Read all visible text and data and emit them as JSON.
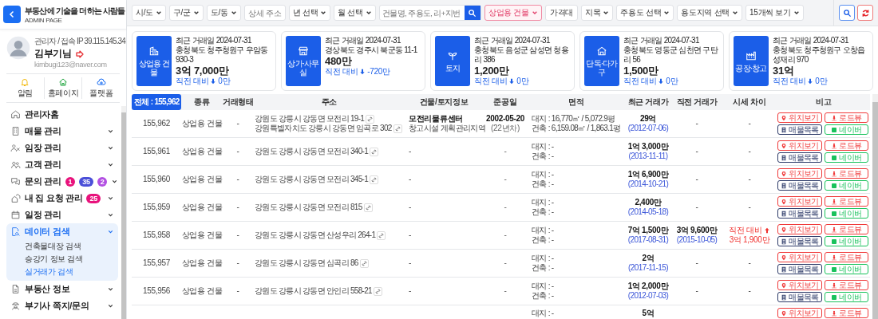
{
  "sidebar": {
    "brand": {
      "title": "부동산에 기술을 더하는 사람들",
      "subtitle": "ADMIN PAGE"
    },
    "profile": {
      "meta": "관리자 / 접속 IP 39.115.145.34",
      "name": "김부기님",
      "email": "kimbugi123@naver.com"
    },
    "quick_links": [
      {
        "label": "알림"
      },
      {
        "label": "홈페이지"
      },
      {
        "label": "플랫폼"
      }
    ],
    "nav": [
      {
        "label": "관리자홈",
        "kind": "link",
        "selected": false
      },
      {
        "label": "매물 관리",
        "kind": "group",
        "selected": false,
        "expanded": false
      },
      {
        "label": "임장 관리",
        "kind": "group",
        "selected": false,
        "expanded": false
      },
      {
        "label": "고객 관리",
        "kind": "group",
        "selected": false,
        "expanded": false
      },
      {
        "label": "문의 관리",
        "kind": "group",
        "selected": false,
        "expanded": false,
        "badges": [
          {
            "text": "1",
            "color": "#e8127c"
          },
          {
            "text": "35",
            "color": "#4a4fd8"
          },
          {
            "text": "2",
            "color": "#b24fe2"
          }
        ]
      },
      {
        "label": "내 집 요청 관리",
        "kind": "group",
        "selected": false,
        "expanded": false,
        "badges": [
          {
            "text": "25",
            "color": "#e8127c"
          }
        ]
      },
      {
        "label": "일정 관리",
        "kind": "group",
        "selected": false,
        "expanded": false
      },
      {
        "label": "데이터 검색",
        "kind": "group",
        "selected": true,
        "expanded": true,
        "children": [
          {
            "label": "건축물대장 검색",
            "selected": false
          },
          {
            "label": "승강기 정보 검색",
            "selected": false
          },
          {
            "label": "실거래가 검색",
            "selected": true
          }
        ]
      },
      {
        "label": "부동산 정보",
        "kind": "group",
        "selected": false,
        "expanded": false
      },
      {
        "label": "부기사 쪽지/문의",
        "kind": "group",
        "selected": false,
        "expanded": false
      }
    ]
  },
  "filters": [
    {
      "kind": "select",
      "label": "시/도",
      "active": false
    },
    {
      "kind": "select",
      "label": "구/군",
      "active": false
    },
    {
      "kind": "select",
      "label": "도/동",
      "active": false
    },
    {
      "kind": "input",
      "placeholder": "상세 주소"
    },
    {
      "kind": "select",
      "label": "년 선택",
      "active": false
    },
    {
      "kind": "select",
      "label": "월 선택",
      "active": false
    },
    {
      "kind": "search",
      "placeholder": "건물명, 주용도, 리+지번"
    },
    {
      "kind": "select",
      "label": "상업용 건물",
      "active": true
    },
    {
      "kind": "button",
      "label": "가격대"
    },
    {
      "kind": "select",
      "label": "지목",
      "active": false
    },
    {
      "kind": "select",
      "label": "주용도 선택",
      "active": false
    },
    {
      "kind": "select",
      "label": "용도지역 선택",
      "active": false
    },
    {
      "kind": "select",
      "label": "15개씩 보기",
      "active": false
    }
  ],
  "cards": [
    {
      "category": "상업용 건물",
      "date": "최근 거래일 2024-07-31",
      "address": "충청북도 청주청원구 우암동 930-3",
      "price": "3억 7,000만",
      "change": {
        "label": "직전 대비",
        "rising": false,
        "amount": "0만"
      }
    },
    {
      "category": "상가·사무실",
      "date": "최근 거래일 2024-07-31",
      "address": "경상북도 경주시 북군동 11-1",
      "price": "480만",
      "change": {
        "label": "직전 대비",
        "rising": false,
        "amount": "-720만"
      }
    },
    {
      "category": "토지",
      "date": "최근 거래일 2024-07-31",
      "address": "충청북도 음성군 삼성면 청용리 386",
      "price": "1,200만",
      "change": {
        "label": "직전 대비",
        "rising": false,
        "amount": "0만"
      }
    },
    {
      "category": "단독·다가구",
      "date": "최근 거래일 2024-07-31",
      "address": "충청북도 영동군 심천면 구탄리 56",
      "price": "1,500만",
      "change": {
        "label": "직전 대비",
        "rising": false,
        "amount": "0만"
      }
    },
    {
      "category": "공장·창고",
      "date": "최근 거래일 2024-07-31",
      "address": "충청북도 청주청원구 오창읍 성재리 970",
      "price": "31억",
      "change": {
        "label": "직전 대비",
        "rising": false,
        "amount": "0만"
      }
    }
  ],
  "table": {
    "total_tab": {
      "label": "전체 : 155,962",
      "selected": true
    },
    "columns": [
      "종류",
      "거래형태",
      "주소",
      "건물/토지정보",
      "준공일",
      "면적",
      "최근 거래가",
      "직전 거래가",
      "시세 차이",
      "비고"
    ],
    "rows": [
      {
        "no": "155,962",
        "type": "상업용 건물",
        "deal": "-",
        "addresses": [
          "강원도 강릉시 강동면 모전리 19-1",
          "강원특별자치도 강릉시 강동면 임곡로 302"
        ],
        "building": {
          "name": "모전리물류센터",
          "info": "창고시설 계획관리지역"
        },
        "completed": {
          "date": "2002-05-20",
          "age": "(22년차)"
        },
        "area": [
          "대지 : 16,770㎡ / 5,072.9평",
          "건축 : 6,159.08㎡ / 1,863.1평"
        ],
        "price": "29억",
        "price_date": "(2012-07-06)",
        "prev_price": "-",
        "diff": "-",
        "actions": [
          {
            "kind": "map",
            "label": "위치보기"
          },
          {
            "kind": "roadview",
            "label": "로드뷰"
          },
          {
            "kind": "list",
            "label": "매물목록"
          },
          {
            "kind": "naver",
            "label": "네이버"
          }
        ]
      },
      {
        "no": "155,961",
        "type": "상업용 건물",
        "deal": "-",
        "addresses": [
          "강원도 강릉시 강동면 모전리 340-1"
        ],
        "building": "-",
        "completed": "-",
        "area": [
          "대지 : -",
          "건축 : -"
        ],
        "price": "1억 3,000만",
        "price_date": "(2013-11-11)",
        "prev_price": "-",
        "diff": "-",
        "actions": [
          {
            "kind": "map",
            "label": "위치보기"
          },
          {
            "kind": "roadview",
            "label": "로드뷰"
          },
          {
            "kind": "list",
            "label": "매물목록"
          },
          {
            "kind": "naver",
            "label": "네이버"
          }
        ]
      },
      {
        "no": "155,960",
        "type": "상업용 건물",
        "deal": "-",
        "addresses": [
          "강원도 강릉시 강동면 모전리 345-1"
        ],
        "building": "-",
        "completed": "-",
        "area": [
          "대지 : -",
          "건축 : -"
        ],
        "price": "1억 6,900만",
        "price_date": "(2014-10-21)",
        "prev_price": "-",
        "diff": "-",
        "actions": [
          {
            "kind": "map",
            "label": "위치보기"
          },
          {
            "kind": "roadview",
            "label": "로드뷰"
          },
          {
            "kind": "list",
            "label": "매물목록"
          },
          {
            "kind": "naver",
            "label": "네이버"
          }
        ]
      },
      {
        "no": "155,959",
        "type": "상업용 건물",
        "deal": "-",
        "addresses": [
          "강원도 강릉시 강동면 모전리 815"
        ],
        "building": "-",
        "completed": "-",
        "area": [
          "대지 : -",
          "건축 : -"
        ],
        "price": "2,400만",
        "price_date": "(2014-05-18)",
        "prev_price": "-",
        "diff": "-",
        "actions": [
          {
            "kind": "map",
            "label": "위치보기"
          },
          {
            "kind": "roadview",
            "label": "로드뷰"
          },
          {
            "kind": "list",
            "label": "매물목록"
          },
          {
            "kind": "naver",
            "label": "네이버"
          }
        ]
      },
      {
        "no": "155,958",
        "type": "상업용 건물",
        "deal": "-",
        "addresses": [
          "강원도 강릉시 강동면 산성우리 264-1"
        ],
        "building": "-",
        "completed": "-",
        "area": [
          "대지 : -",
          "건축 : -"
        ],
        "price": "7억 1,500만",
        "price_date": "(2017-08-31)",
        "prev_price": "3억 9,600만",
        "prev_date": "(2015-10-05)",
        "diff": {
          "label": "직전 대비",
          "rising": true,
          "amount": "3억 1,900만"
        },
        "actions": [
          {
            "kind": "map",
            "label": "위치보기"
          },
          {
            "kind": "roadview",
            "label": "로드뷰"
          },
          {
            "kind": "list",
            "label": "매물목록"
          },
          {
            "kind": "naver",
            "label": "네이버"
          }
        ]
      },
      {
        "no": "155,957",
        "type": "상업용 건물",
        "deal": "-",
        "addresses": [
          "강원도 강릉시 강동면 심곡리 86"
        ],
        "building": "-",
        "completed": "-",
        "area": [
          "대지 : -",
          "건축 : -"
        ],
        "price": "2억",
        "price_date": "(2017-11-15)",
        "prev_price": "-",
        "diff": "-",
        "actions": [
          {
            "kind": "map",
            "label": "위치보기"
          },
          {
            "kind": "roadview",
            "label": "로드뷰"
          },
          {
            "kind": "list",
            "label": "매물목록"
          },
          {
            "kind": "naver",
            "label": "네이버"
          }
        ]
      },
      {
        "no": "155,956",
        "type": "상업용 건물",
        "deal": "-",
        "addresses": [
          "강원도 강릉시 강동면 안인리 558-21"
        ],
        "building": "-",
        "completed": "-",
        "area": [
          "대지 : -",
          "건축 : -"
        ],
        "price": "1억 2,000만",
        "price_date": "(2012-07-03)",
        "prev_price": "-",
        "diff": "-",
        "actions": [
          {
            "kind": "map",
            "label": "위치보기"
          },
          {
            "kind": "roadview",
            "label": "로드뷰"
          },
          {
            "kind": "list",
            "label": "매물목록"
          },
          {
            "kind": "naver",
            "label": "네이버"
          }
        ]
      },
      {
        "area": [
          "대지 : -"
        ],
        "price": "5억",
        "actions": [
          {
            "kind": "map",
            "label": "위치보기"
          },
          {
            "kind": "roadview",
            "label": "로드뷰"
          }
        ]
      }
    ]
  }
}
